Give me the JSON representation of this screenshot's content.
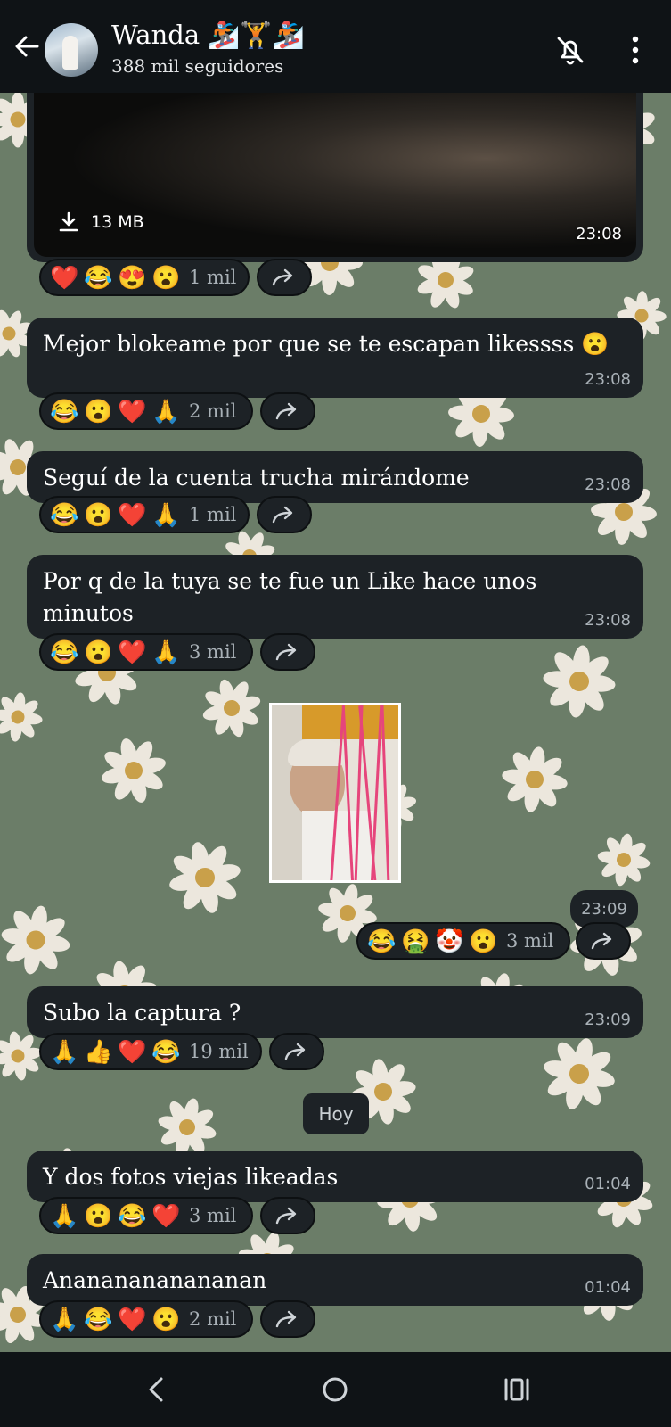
{
  "header": {
    "title": "Wanda 🏂🏋🏂",
    "subtitle": "388 mil seguidores",
    "icons": [
      "back-arrow-icon",
      "avatar",
      "bell-off-icon",
      "more-vertical-icon"
    ]
  },
  "media": {
    "size": "13 MB",
    "time": "23:08"
  },
  "messages": [
    {
      "text": "",
      "time": "",
      "reactions": [
        "❤️",
        "😂",
        "😍",
        "😮"
      ],
      "count": "1 mil"
    },
    {
      "text": "Mejor blokeame por que se te escapan likessss 😮",
      "time": "23:08",
      "reactions": [
        "😂",
        "😮",
        "❤️",
        "🙏"
      ],
      "count": "2 mil"
    },
    {
      "text": "Seguí de la cuenta trucha mirándome",
      "time": "23:08",
      "reactions": [
        "😂",
        "😮",
        "❤️",
        "🙏"
      ],
      "count": "1 mil"
    },
    {
      "text": "Por q de la tuya se te fue un Like hace unos minutos",
      "time": "23:08",
      "reactions": [
        "😂",
        "😮",
        "❤️",
        "🙏"
      ],
      "count": "3 mil"
    },
    {
      "text": "",
      "time": "23:09",
      "reactions": [
        "😂",
        "🤮",
        "🤡",
        "😮"
      ],
      "count": "3 mil"
    },
    {
      "text": "Subo la captura ?",
      "time": "23:09",
      "reactions": [
        "🙏",
        "👍",
        "❤️",
        "😂"
      ],
      "count": "19 mil"
    },
    {
      "text": "Y dos fotos viejas likeadas",
      "time": "01:04",
      "reactions": [
        "🙏",
        "😮",
        "😂",
        "❤️"
      ],
      "count": "3 mil"
    },
    {
      "text": "Anananananananan",
      "time": "01:04",
      "reactions": [
        "🙏",
        "😂",
        "❤️",
        "😮"
      ],
      "count": "2 mil"
    }
  ],
  "day_separator": "Hoy",
  "colors": {
    "header_bg": "#0f1316",
    "bubble_bg": "#1d2226",
    "wallpaper": "#6b7d68",
    "meta_text": "#a9b1b7"
  }
}
